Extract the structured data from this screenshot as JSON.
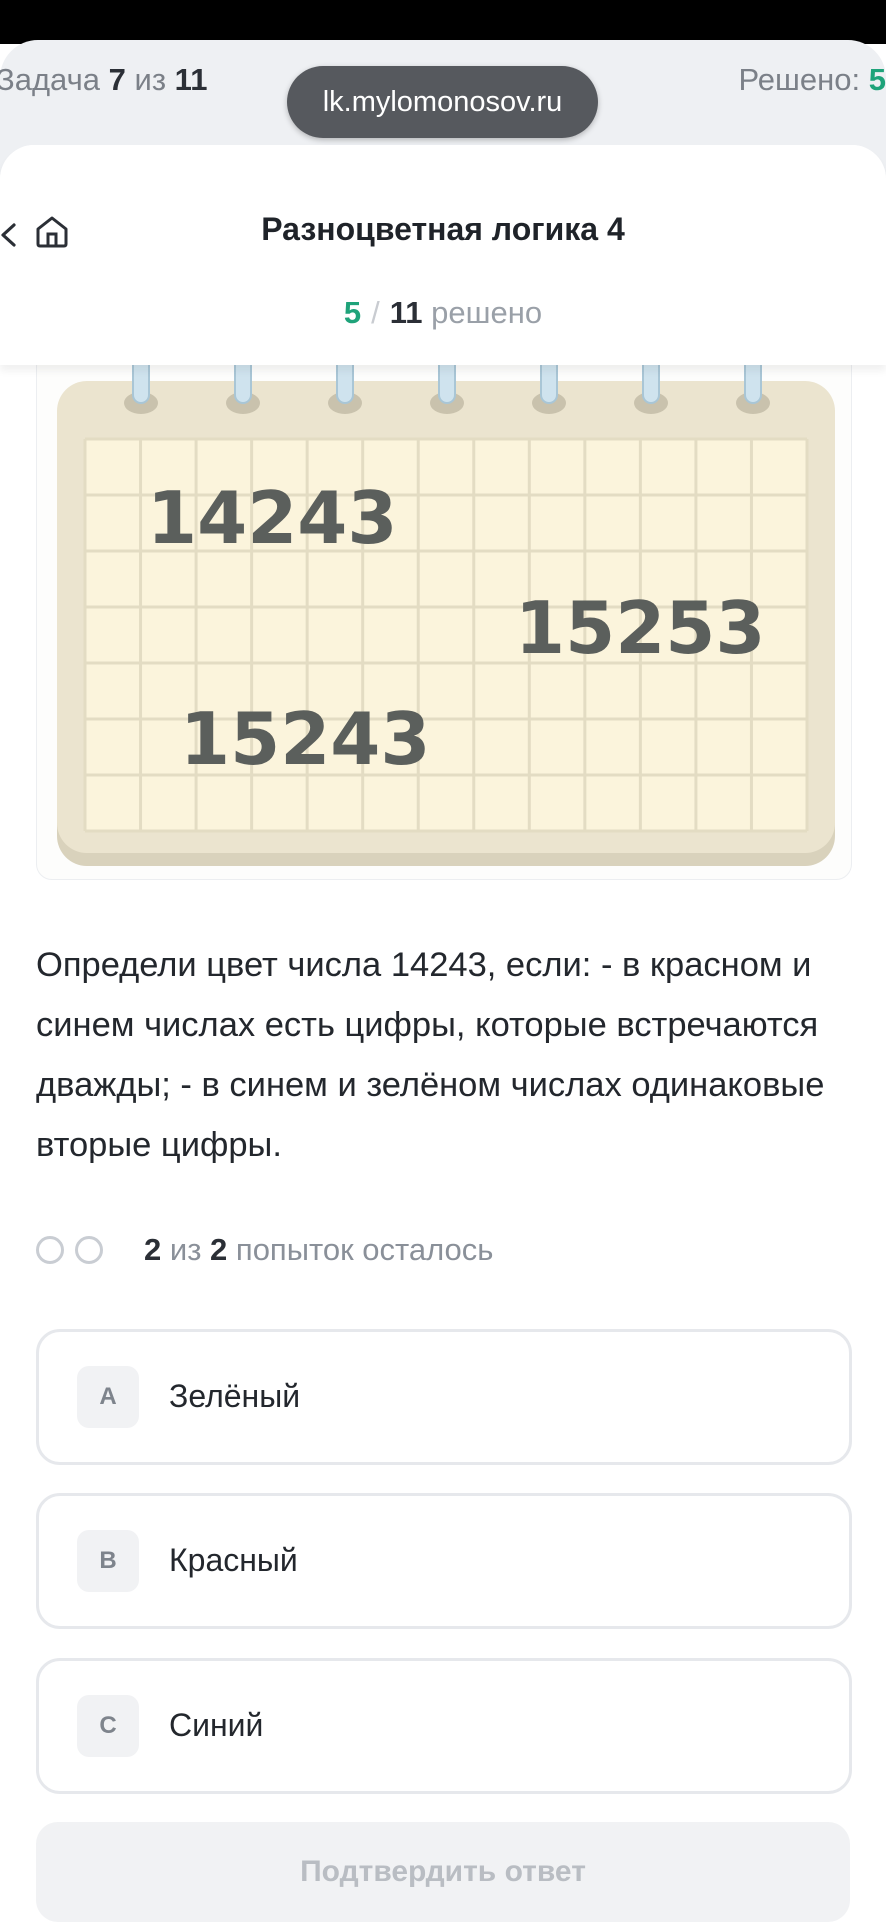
{
  "top": {
    "task_prefix": "Задача",
    "task_current": "7",
    "task_of": "из",
    "task_total": "11",
    "url": "lk.mylomonosov.ru",
    "solved_prefix": "Решено:",
    "solved_count": "5"
  },
  "header": {
    "title": "Разноцветная логика 4",
    "progress_done": "5",
    "progress_sep": "/",
    "progress_total": "11",
    "progress_suffix": "решено"
  },
  "image": {
    "numbers": [
      "14243",
      "15253",
      "15243"
    ]
  },
  "question": "Определи цвет числа 14243, если: - в красном и синем числах есть цифры, которые встречаются дважды; - в синем и зелёном числах одинаковые вторые цифры.",
  "attempts": {
    "left": "2",
    "of": "из",
    "total": "2",
    "suffix": "попыток осталось"
  },
  "options": [
    {
      "letter": "A",
      "label": "Зелёный"
    },
    {
      "letter": "B",
      "label": "Красный"
    },
    {
      "letter": "C",
      "label": "Синий"
    }
  ],
  "submit_label": "Подтвердить ответ",
  "colors": {
    "accent_green": "#1fa37a",
    "pill": "#56595e",
    "paper": "#fbf4dc",
    "frame": "#e9e2cd"
  }
}
